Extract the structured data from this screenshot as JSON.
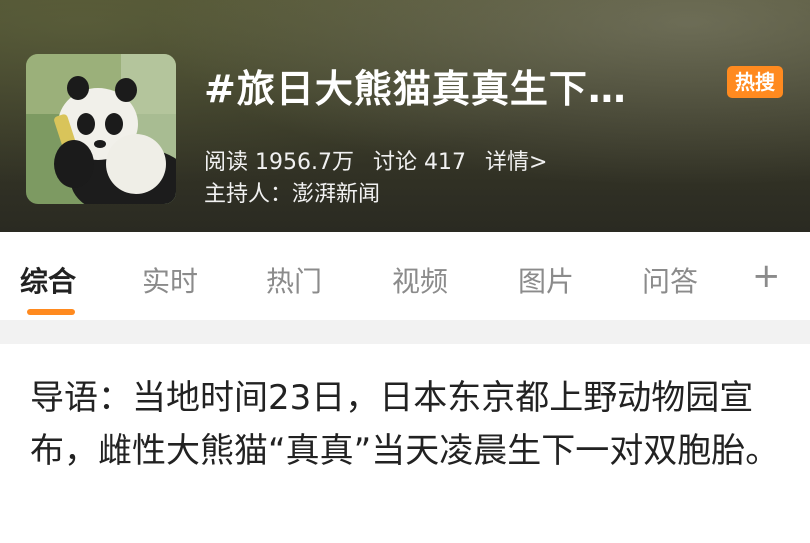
{
  "topic": {
    "title": "#旅日大熊猫真真生下…",
    "badge": "热搜",
    "reads": "阅读 1956.7万",
    "discussions": "讨论 417",
    "details": "详情>",
    "host": "主持人：澎湃新闻"
  },
  "tabs": [
    "综合",
    "实时",
    "热门",
    "视频",
    "图片",
    "问答"
  ],
  "active_tab": "综合",
  "add_tab_icon": "plus-icon",
  "lead": "导语：当地时间23日，日本东京都上野动物园宣布，雌性大熊猫“真真”当天凌晨生下一对双胞胎。",
  "colors": {
    "accent": "#ff8a1f"
  }
}
